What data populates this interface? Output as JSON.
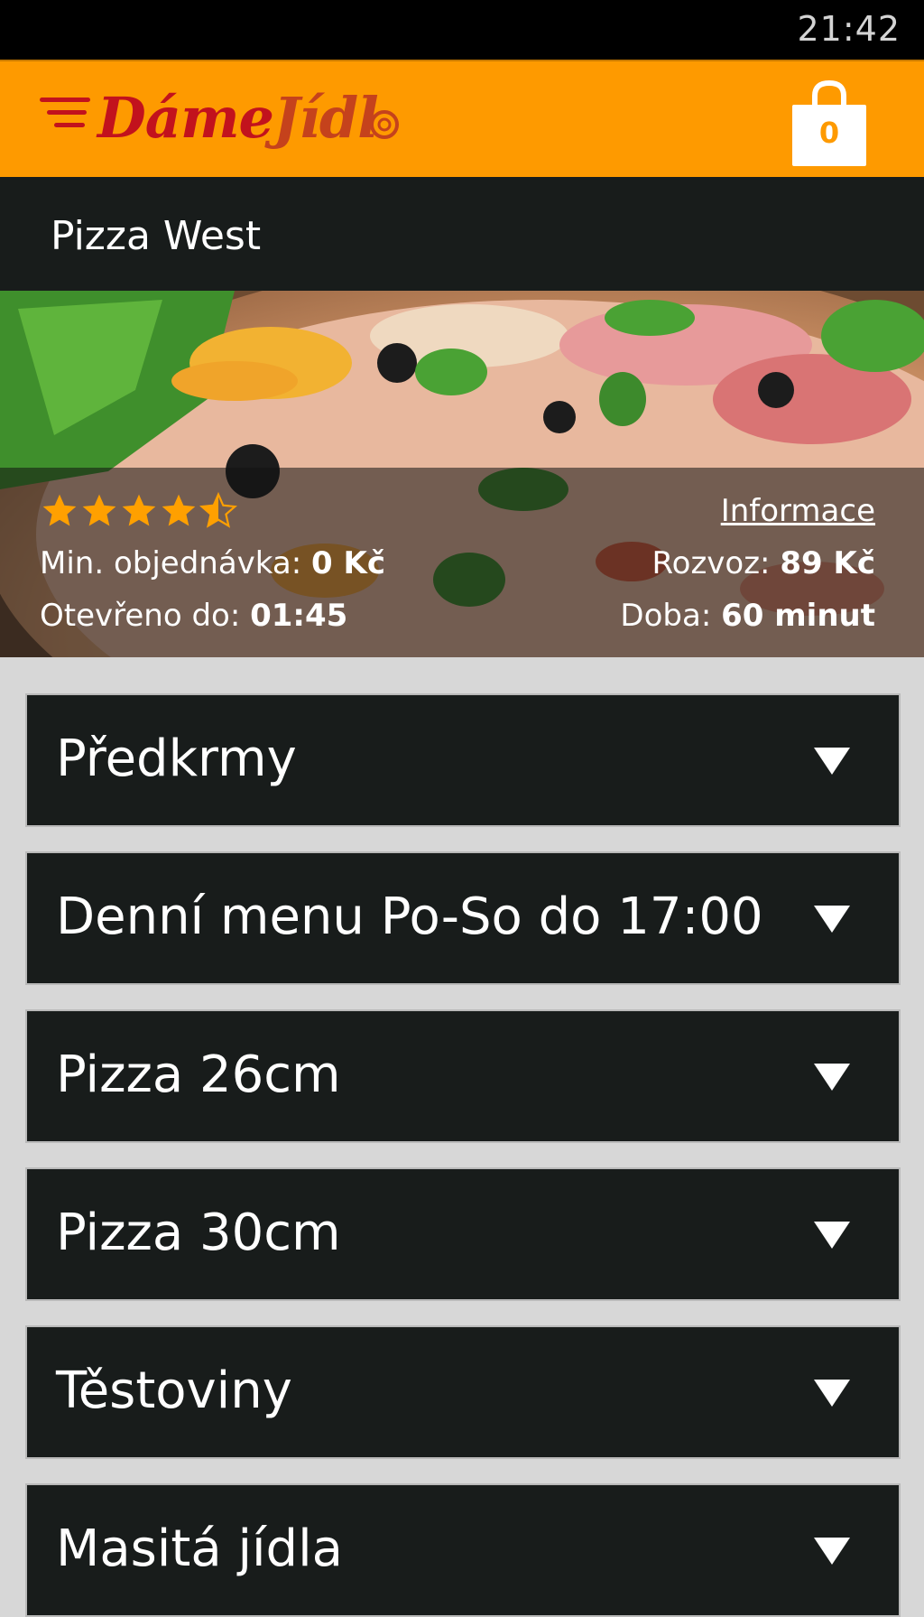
{
  "status_bar": {
    "time": "21:42"
  },
  "app_bar": {
    "logo_text_part1": "Dáme",
    "logo_text_part2": "Jídl",
    "cart_count": "0"
  },
  "restaurant": {
    "name": "Pizza West",
    "rating": 4.5,
    "info_link": "Informace",
    "min_order_label": "Min. objednávka:",
    "min_order_value": "0 Kč",
    "delivery_label": "Rozvoz:",
    "delivery_value": "89 Kč",
    "open_label": "Otevřeno do:",
    "open_value": "01:45",
    "time_label": "Doba:",
    "time_value": "60 minut"
  },
  "categories": [
    {
      "label": "Předkrmy"
    },
    {
      "label": "Denní menu Po-So do 17:00"
    },
    {
      "label": "Pizza 26cm"
    },
    {
      "label": "Pizza 30cm"
    },
    {
      "label": "Těstoviny"
    },
    {
      "label": "Masitá jídla"
    }
  ],
  "colors": {
    "accent": "#fe9a00",
    "dark": "#181c1b",
    "background": "#d7d7d7",
    "logo_red": "#c2121d"
  }
}
